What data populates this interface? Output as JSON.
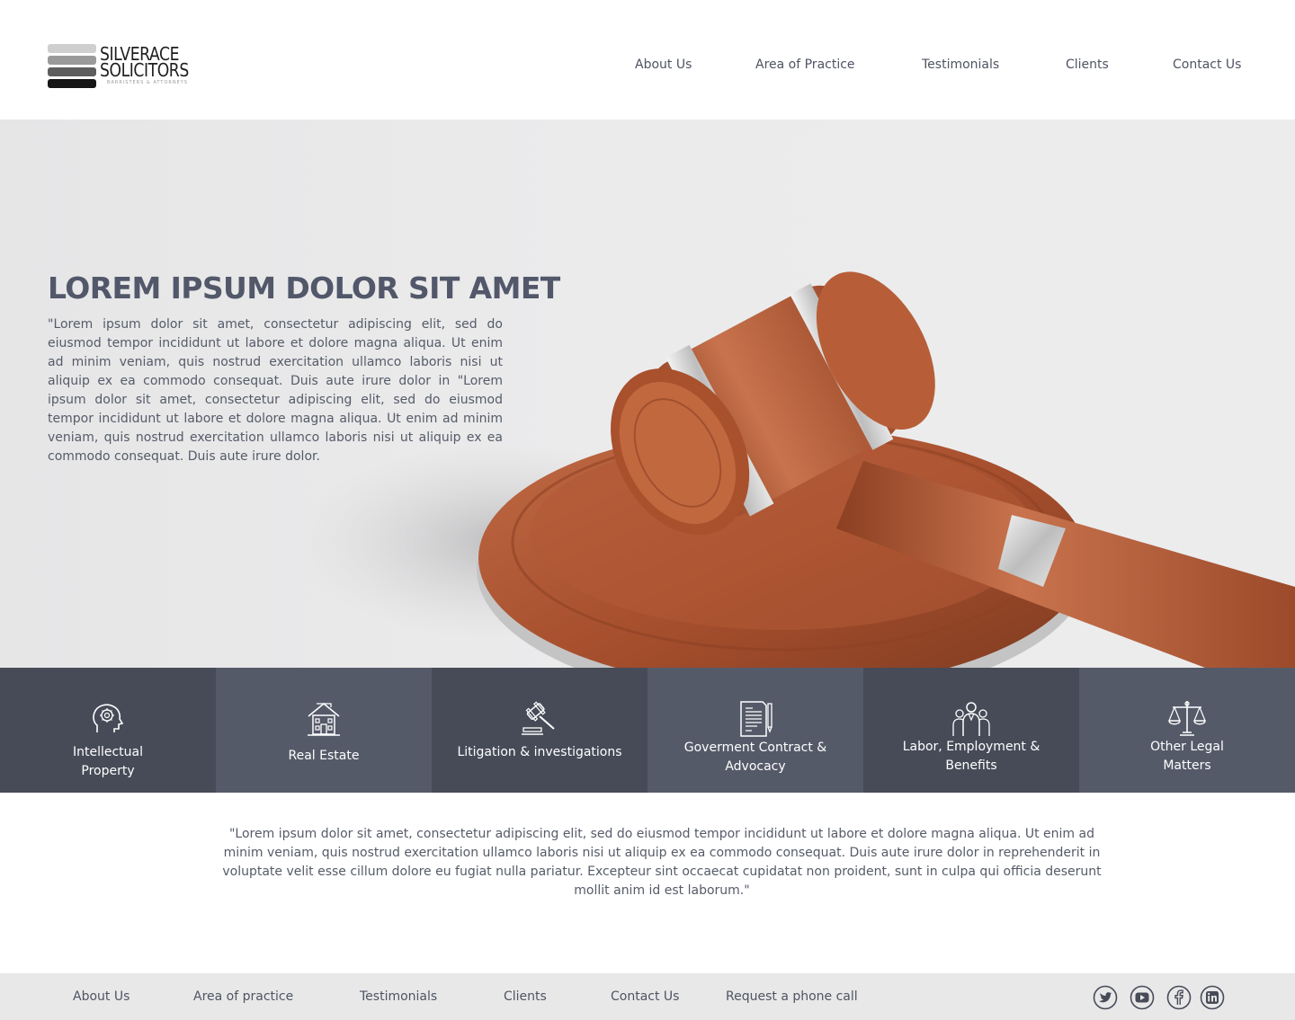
{
  "brand": {
    "name_line1": "SILVERACE",
    "name_line2": "SOLICITORS",
    "tagline": "BARRISTERS & ATTORNEYS"
  },
  "nav": {
    "items": [
      {
        "label": "About Us"
      },
      {
        "label": "Area of Practice"
      },
      {
        "label": "Testimonials"
      },
      {
        "label": "Clients"
      },
      {
        "label": "Contact Us"
      }
    ]
  },
  "hero": {
    "title": "LOREM IPSUM DOLOR SIT AMET",
    "body": "\"Lorem ipsum dolor sit amet, consectetur adipiscing elit, sed do eiusmod tempor incididunt ut labore et dolore magna aliqua. Ut enim ad minim veniam, quis nostrud exercitation ullamco laboris nisi ut aliquip ex ea commodo consequat. Duis aute irure dolor in \"Lorem ipsum dolor sit amet, consectetur adipiscing elit, sed do eiusmod tempor incididunt ut labore et dolore magna aliqua. Ut enim ad minim veniam, quis nostrud exercitation ullamco laboris nisi ut aliquip ex ea commodo consequat. Duis aute irure dolor.",
    "image_icon": "gavel-image"
  },
  "practice_areas": [
    {
      "line1": "Intellectual",
      "line2": "Property",
      "icon": "brain-head-icon"
    },
    {
      "line1": "Real Estate",
      "line2": "",
      "icon": "house-icon"
    },
    {
      "line1": "Litigation & investigations",
      "line2": "",
      "icon": "gavel-icon"
    },
    {
      "line1": "Goverment Contract &",
      "line2": "Advocacy",
      "icon": "document-pen-icon"
    },
    {
      "line1": "Labor, Employment &",
      "line2": "Benefits",
      "icon": "people-group-icon"
    },
    {
      "line1": "Other Legal",
      "line2": "Matters",
      "icon": "scales-icon"
    }
  ],
  "quote": "\"Lorem ipsum dolor sit amet, consectetur adipiscing elit, sed do eiusmod tempor incididunt ut labore et dolore magna aliqua. Ut enim ad minim veniam, quis nostrud exercitation ullamco laboris nisi ut aliquip ex ea commodo consequat. Duis aute irure dolor in reprehenderit in voluptate velit esse cillum dolore eu fugiat nulla pariatur. Excepteur sint occaecat cupidatat non proident, sunt in culpa qui officia deserunt mollit anim id est laborum.\"",
  "footer": {
    "links": [
      {
        "label": "About Us"
      },
      {
        "label": "Area of practice"
      },
      {
        "label": "Testimonials"
      },
      {
        "label": "Clients"
      },
      {
        "label": "Contact Us"
      },
      {
        "label": "Request a phone call"
      }
    ],
    "social": [
      "twitter-icon",
      "youtube-icon",
      "facebook-icon",
      "linkedin-icon"
    ]
  },
  "colors": {
    "tile_dark": "#474b58",
    "tile_light": "#555a69",
    "heading": "#52586a",
    "footer_bg": "#e8e8e9"
  }
}
